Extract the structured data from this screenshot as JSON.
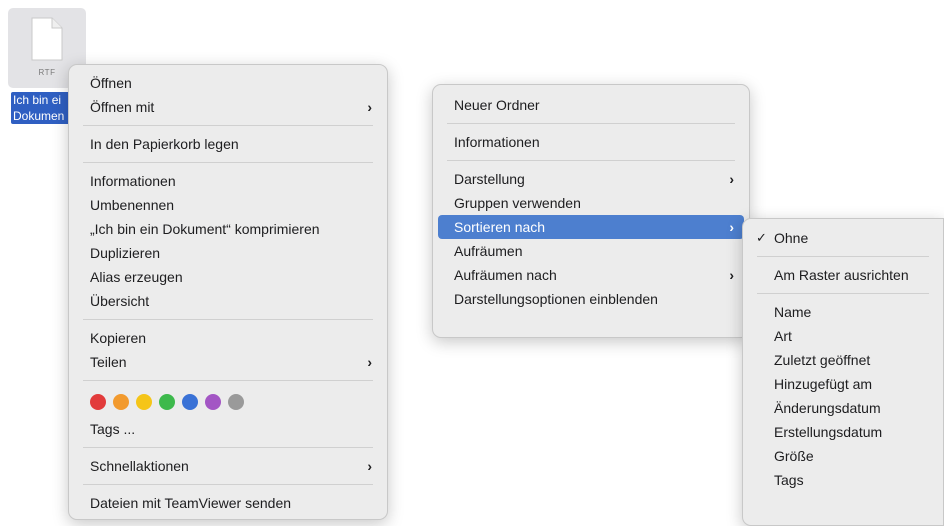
{
  "file": {
    "ext": "RTF",
    "label_line1": "Ich bin ei",
    "label_line2": "Dokumen"
  },
  "context_menu": {
    "items": [
      {
        "label": "Öffnen"
      },
      {
        "label": "Öffnen mit",
        "submenu": true
      },
      {
        "label": "In den Papierkorb legen"
      },
      {
        "label": "Informationen"
      },
      {
        "label": "Umbenennen"
      },
      {
        "label": "„Ich bin ein Dokument“ komprimieren"
      },
      {
        "label": "Duplizieren"
      },
      {
        "label": "Alias erzeugen"
      },
      {
        "label": "Übersicht"
      },
      {
        "label": "Kopieren"
      },
      {
        "label": "Teilen",
        "submenu": true
      },
      {
        "label": "Tags ..."
      },
      {
        "label": "Schnellaktionen",
        "submenu": true
      },
      {
        "label": "Dateien mit TeamViewer senden"
      }
    ],
    "tag_colors": [
      "#e23b3b",
      "#f29a2e",
      "#f5c518",
      "#3db94c",
      "#3a72d6",
      "#a356c4",
      "#9a9a9a"
    ],
    "chevron": "›"
  },
  "desktop_menu": {
    "items": [
      {
        "label": "Neuer Ordner"
      },
      {
        "label": "Informationen"
      },
      {
        "label": "Darstellung",
        "submenu": true
      },
      {
        "label": "Gruppen verwenden"
      },
      {
        "label": "Sortieren nach",
        "submenu": true,
        "selected": true
      },
      {
        "label": "Aufräumen"
      },
      {
        "label": "Aufräumen nach",
        "submenu": true
      },
      {
        "label": "Darstellungsoptionen einblenden"
      }
    ]
  },
  "sort_menu": {
    "check": "✓",
    "items": [
      {
        "label": "Ohne",
        "checked": true
      },
      {
        "label": "Am Raster ausrichten"
      },
      {
        "label": "Name"
      },
      {
        "label": "Art"
      },
      {
        "label": "Zuletzt geöffnet"
      },
      {
        "label": "Hinzugefügt am"
      },
      {
        "label": "Änderungsdatum"
      },
      {
        "label": "Erstellungsdatum"
      },
      {
        "label": "Größe"
      },
      {
        "label": "Tags"
      }
    ]
  },
  "colors": {
    "selection": "#4d7fcf",
    "file_label_bg": "#2f5fc2",
    "menu_bg": "#ececec"
  }
}
